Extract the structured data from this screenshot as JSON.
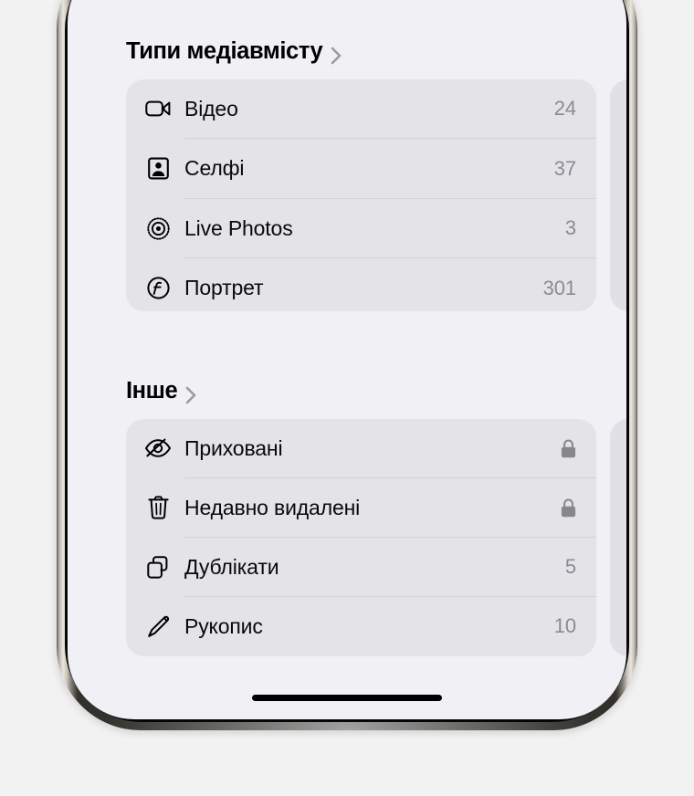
{
  "device": {
    "home_indicator": "home-indicator"
  },
  "screen": {
    "sections": [
      {
        "id": "media-types",
        "title": "Типи медіавмісту",
        "chevron_icon": "chevron-right-icon",
        "rows": [
          {
            "icon": "video-camera-icon",
            "label": "Відео",
            "count": "24",
            "lock": false
          },
          {
            "icon": "selfie-person-icon",
            "label": "Селфі",
            "count": "37",
            "lock": false
          },
          {
            "icon": "live-photo-icon",
            "label": "Live Photos",
            "count": "3",
            "lock": false
          },
          {
            "icon": "aperture-f-icon",
            "label": "Портрет",
            "count": "301",
            "lock": false
          }
        ]
      },
      {
        "id": "other",
        "title": "Інше",
        "chevron_icon": "chevron-right-icon",
        "rows": [
          {
            "icon": "eye-slash-icon",
            "label": "Приховані",
            "count": "",
            "lock": true
          },
          {
            "icon": "trash-icon",
            "label": "Недавно видалені",
            "count": "",
            "lock": true
          },
          {
            "icon": "duplicate-icon",
            "label": "Дублікати",
            "count": "5",
            "lock": false
          },
          {
            "icon": "pencil-icon",
            "label": "Рукопис",
            "count": "10",
            "lock": false
          }
        ]
      }
    ]
  },
  "colors": {
    "page_background": "#f2f2f2",
    "screen_background": "#f1f1f5",
    "card_background": "#e3e3e8",
    "separator": "#d2d2d8",
    "label_text": "#0a0a0a",
    "count_text": "#8b8b91",
    "lock_icon": "#86868b",
    "chevron": "#9a9a9f",
    "home_indicator": "#000000"
  }
}
